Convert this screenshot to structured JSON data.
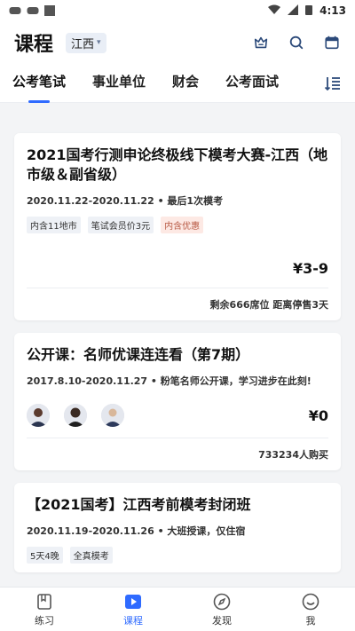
{
  "status": {
    "time": "4:13"
  },
  "header": {
    "title": "课程",
    "region": "江西"
  },
  "tabs": [
    {
      "label": "公考笔试"
    },
    {
      "label": "事业单位"
    },
    {
      "label": "财会"
    },
    {
      "label": "公考面试"
    }
  ],
  "cards": [
    {
      "title": "2021国考行测申论终极线下模考大赛-江西（地市级＆副省级）",
      "subtitle": "2020.11.22-2020.11.22 • 最后1次模考",
      "tags": [
        "内含11地市",
        "笔试会员价3元",
        "内含优惠"
      ],
      "price": "¥3-9",
      "meta": "剩余666席位 距离停售3天"
    },
    {
      "title": "公开课：名师优课连连看（第7期）",
      "subtitle": "2017.8.10-2020.11.27 • 粉笔名师公开课，学习进步在此刻!",
      "price": "¥0",
      "meta": "733234人购买"
    },
    {
      "title": "【2021国考】江西考前模考封闭班",
      "subtitle": "2020.11.19-2020.11.26 • 大班授课，仅住宿",
      "tags": [
        "5天4晚",
        "全真模考"
      ]
    }
  ],
  "bottom_nav": [
    {
      "label": "练习",
      "icon": "book-icon"
    },
    {
      "label": "课程",
      "icon": "play-icon"
    },
    {
      "label": "发现",
      "icon": "compass-icon"
    },
    {
      "label": "我",
      "icon": "smile-icon"
    }
  ],
  "colors": {
    "accent": "#2f6bff",
    "icon": "#2c4a7a"
  }
}
